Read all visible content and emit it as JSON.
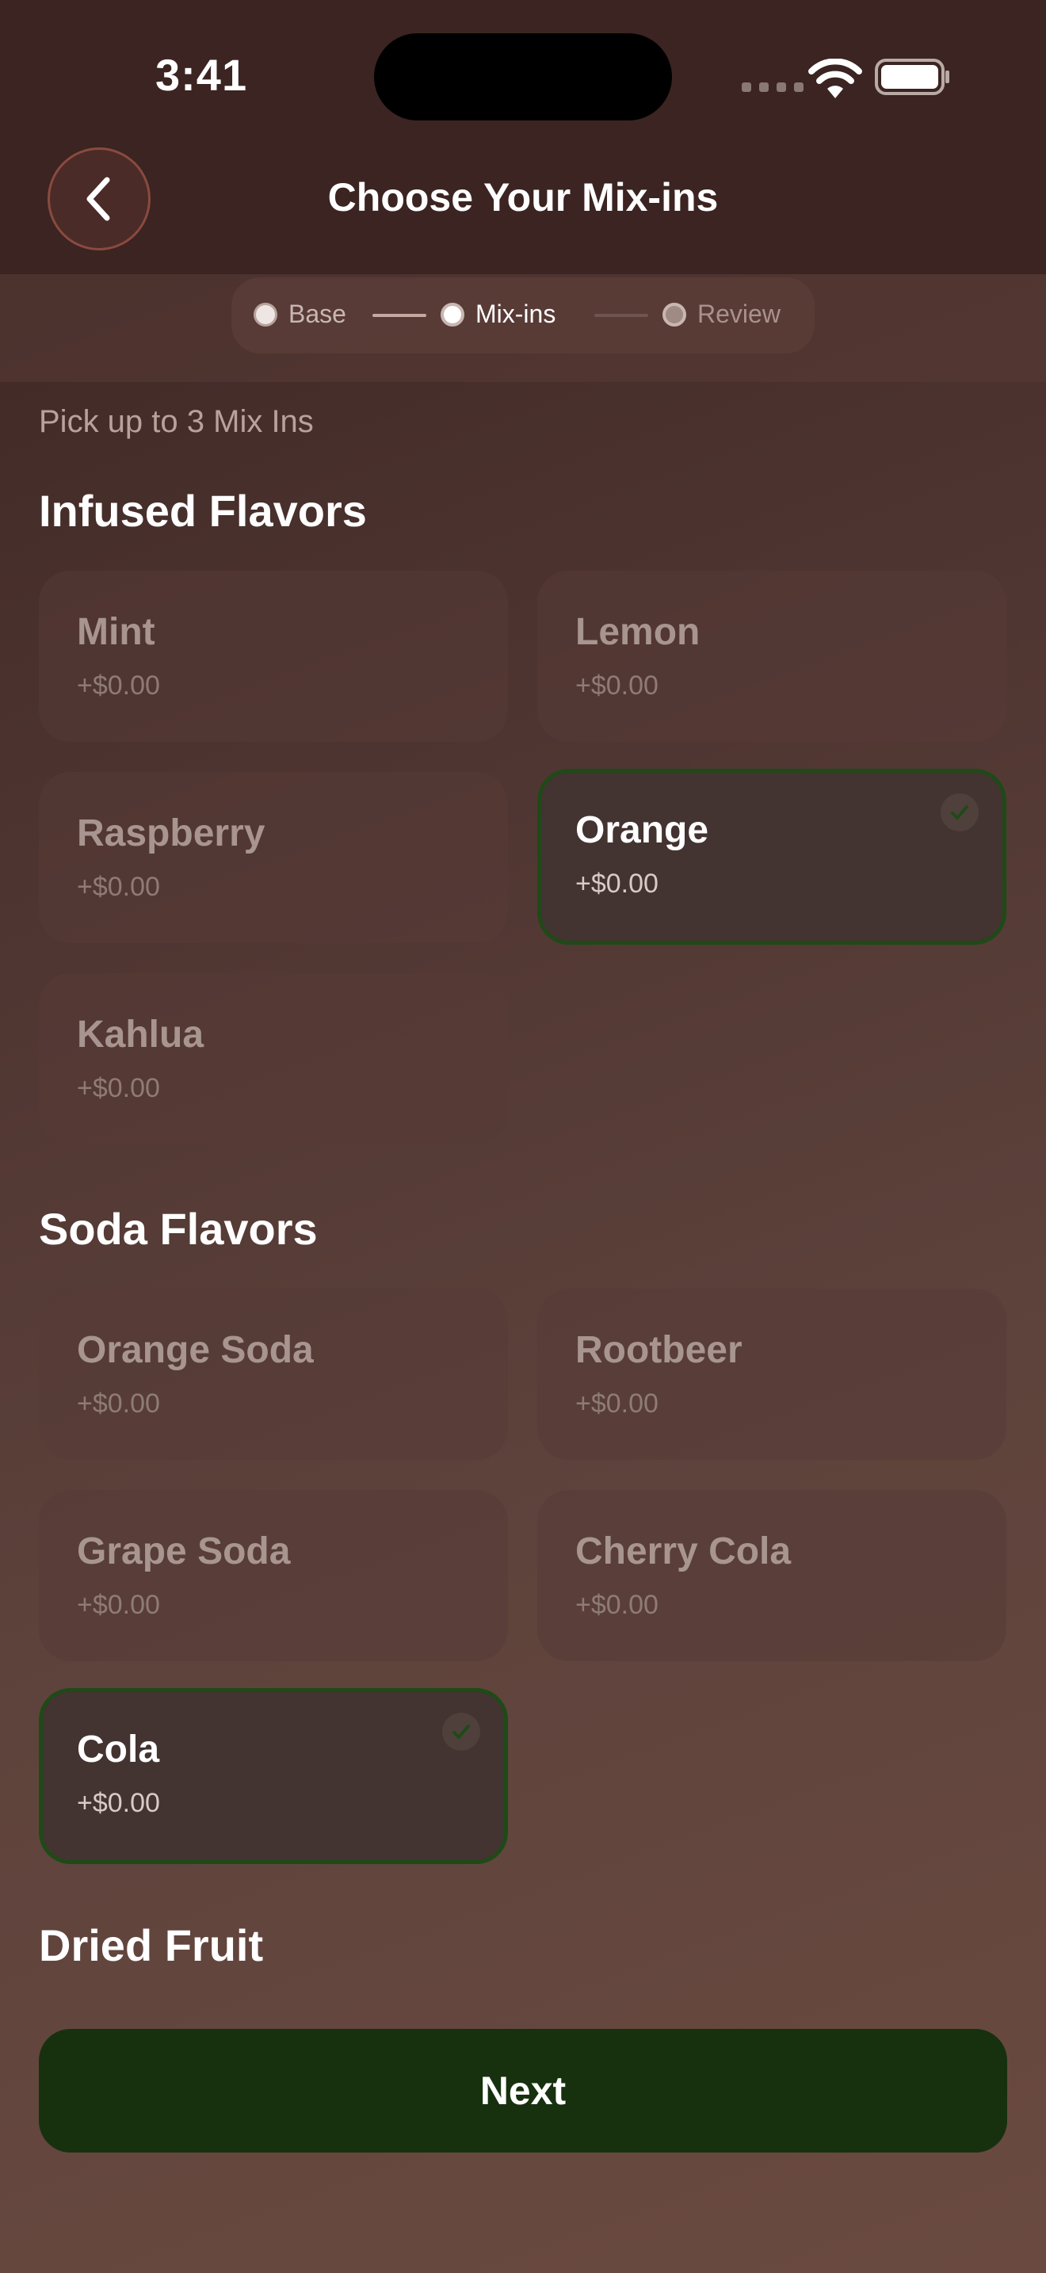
{
  "status_bar": {
    "time": "3:41"
  },
  "header": {
    "title": "Choose Your Mix-ins",
    "back_icon": "chevron-left-icon"
  },
  "stepper": {
    "steps": [
      {
        "label": "Base",
        "state": "done"
      },
      {
        "label": "Mix-ins",
        "state": "current"
      },
      {
        "label": "Review",
        "state": "upcoming"
      }
    ]
  },
  "instruction": "Pick up to 3 Mix Ins",
  "sections": [
    {
      "title": "Infused Flavors",
      "items": [
        {
          "name": "Mint",
          "price": "+$0.00",
          "selected": false
        },
        {
          "name": "Lemon",
          "price": "+$0.00",
          "selected": false
        },
        {
          "name": "Raspberry",
          "price": "+$0.00",
          "selected": false
        },
        {
          "name": "Orange",
          "price": "+$0.00",
          "selected": true
        },
        {
          "name": "Kahlua",
          "price": "+$0.00",
          "selected": false
        }
      ]
    },
    {
      "title": "Soda Flavors",
      "items": [
        {
          "name": "Orange Soda",
          "price": "+$0.00",
          "selected": false
        },
        {
          "name": "Rootbeer",
          "price": "+$0.00",
          "selected": false
        },
        {
          "name": "Grape Soda",
          "price": "+$0.00",
          "selected": false
        },
        {
          "name": "Cherry Cola",
          "price": "+$0.00",
          "selected": false
        },
        {
          "name": "Cola",
          "price": "+$0.00",
          "selected": true
        }
      ]
    },
    {
      "title": "Dried Fruit",
      "items": []
    }
  ],
  "next_button": {
    "label": "Next"
  },
  "colors": {
    "header_bg": "#3b2421",
    "selected_border": "#1f4a18",
    "next_button_bg": "#17310f"
  }
}
